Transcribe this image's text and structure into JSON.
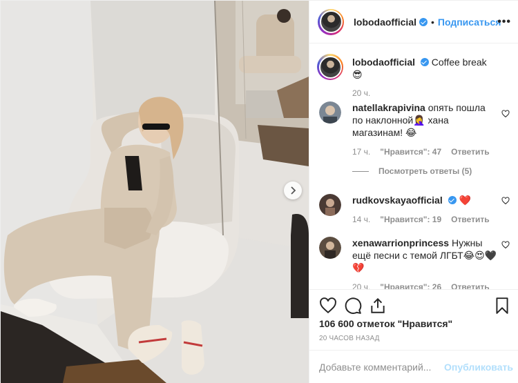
{
  "header": {
    "username": "lobodaofficial",
    "separator": "•",
    "follow_label": "Подписаться",
    "more_label": "•••"
  },
  "caption": {
    "username": "lobodaofficial",
    "text": "Coffee break 😎",
    "time": "20 ч."
  },
  "comments": [
    {
      "username": "natellakrapivina",
      "text": "опять пошла по наклонной🤦‍♀️ хана магазинам! 😂",
      "time": "17 ч.",
      "likes": "\"Нравится\": 47",
      "reply_label": "Ответить",
      "view_replies": "Посмотреть ответы (5)"
    },
    {
      "username": "rudkovskayaofficial",
      "text": "❤️",
      "time": "14 ч.",
      "likes": "\"Нравится\": 19",
      "reply_label": "Ответить"
    },
    {
      "username": "xenawarrionprincess",
      "text": "Нужны ещё песни с темой ЛГБТ😂😍🖤💔",
      "time": "20 ч.",
      "likes": "\"Нравится\": 26",
      "reply_label": "Ответить"
    }
  ],
  "actions": {
    "like_icon": "heart-icon",
    "comment_icon": "comment-icon",
    "share_icon": "share-icon",
    "save_icon": "bookmark-icon"
  },
  "likes_text": "106 600 отметок \"Нравится\"",
  "timestamp": "20 ЧАСОВ НАЗАД",
  "add_comment": {
    "placeholder": "Добавьте комментарий...",
    "publish_label": "Опубликовать"
  },
  "colors": {
    "accent": "#3897f0",
    "publish_disabled": "#b2dffc",
    "muted": "#8e8e8e"
  }
}
